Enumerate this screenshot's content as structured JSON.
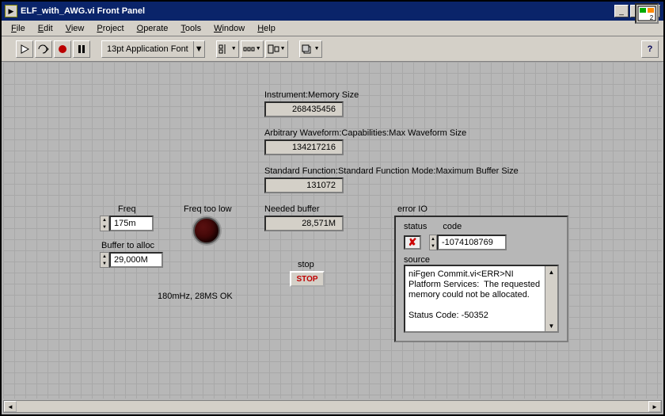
{
  "window": {
    "title": "ELF_with_AWG.vi Front Panel",
    "icon_badge": "2"
  },
  "menu": [
    "File",
    "Edit",
    "View",
    "Project",
    "Operate",
    "Tools",
    "Window",
    "Help"
  ],
  "toolbar": {
    "font_selector": "13pt Application Font"
  },
  "fields": {
    "mem_label": "Instrument:Memory Size",
    "mem_value": "268435456",
    "maxwf_label": "Arbitrary Waveform:Capabilities:Max Waveform Size",
    "maxwf_value": "134217216",
    "maxbuf_label": "Standard Function:Standard Function Mode:Maximum Buffer Size",
    "maxbuf_value": "131072",
    "freq_label": "Freq",
    "freq_value": "175m",
    "buffer_label": "Buffer to alloc",
    "buffer_value": "29,000M",
    "freq_low_label": "Freq too low",
    "needed_label": "Needed buffer",
    "needed_value": "28,571M",
    "stop_label": "stop",
    "stop_button": "STOP",
    "status_line": "180mHz, 28MS OK"
  },
  "error": {
    "cluster_label": "error IO",
    "status_label": "status",
    "code_label": "code",
    "code_value": "-1074108769",
    "status_symbol": "✘",
    "source_label": "source",
    "source_text": "niFgen Commit.vi<ERR>NI Platform Services:  The requested memory could not be allocated.\n\nStatus Code: -50352"
  }
}
